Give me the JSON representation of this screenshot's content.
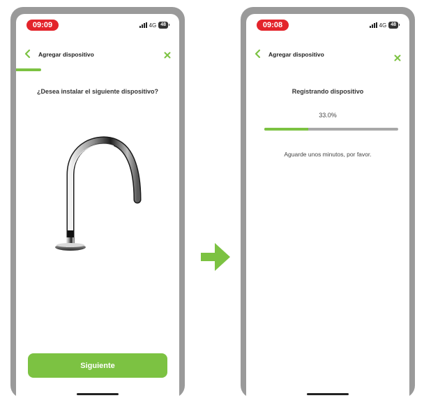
{
  "colors": {
    "accent": "#7cc242",
    "time_pill": "#e3242b",
    "frame": "#9a9a9a"
  },
  "status_bar": {
    "network": "4G",
    "battery": "48"
  },
  "left_screen": {
    "time": "09:09",
    "header_title": "Agregar dispositivo",
    "question": "¿Desea instalar el siguiente dispositivo?",
    "next_label": "Siguiente",
    "icons": {
      "back": "chevron-left-icon",
      "close": "close-icon"
    }
  },
  "right_screen": {
    "time": "09:08",
    "header_title": "Agregar dispositivo",
    "registering_title": "Registrando dispositivo",
    "progress_text": "33.0%",
    "progress_value": 0.33,
    "wait_message": "Aguarde unos minutos, por favor.",
    "icons": {
      "back": "chevron-left-icon",
      "close": "close-icon"
    }
  },
  "transition_icon": "arrow-right-icon"
}
